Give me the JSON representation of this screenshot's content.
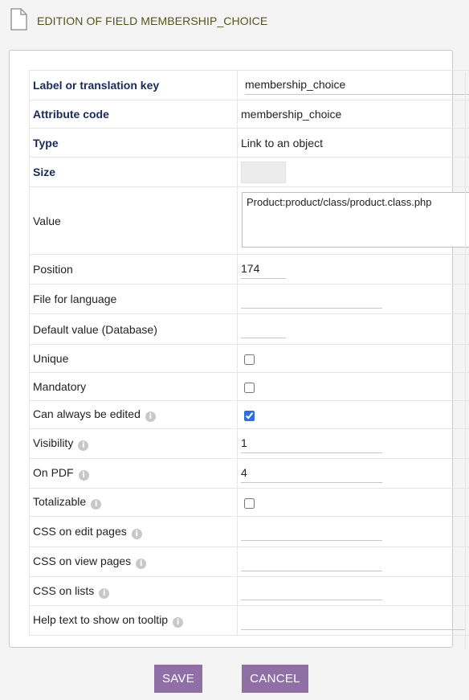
{
  "header": {
    "title": "EDITION OF FIELD MEMBERSHIP_CHOICE"
  },
  "form": {
    "label_key": {
      "label": "Label or translation key",
      "value": "membership_choice"
    },
    "attribute_code": {
      "label": "Attribute code",
      "value": "membership_choice"
    },
    "type": {
      "label": "Type",
      "value": "Link to an object"
    },
    "size": {
      "label": "Size",
      "value": ""
    },
    "value": {
      "label": "Value",
      "value": "Product:product/class/product.class.php"
    },
    "position": {
      "label": "Position",
      "value": "174"
    },
    "file_language": {
      "label": "File for language",
      "value": ""
    },
    "default_value": {
      "label": "Default value (Database)",
      "value": ""
    },
    "unique": {
      "label": "Unique",
      "checked": false
    },
    "mandatory": {
      "label": "Mandatory",
      "checked": false
    },
    "always_editable": {
      "label": "Can always be edited",
      "checked": true
    },
    "visibility": {
      "label": "Visibility",
      "value": "1"
    },
    "on_pdf": {
      "label": "On PDF",
      "value": "4"
    },
    "totalizable": {
      "label": "Totalizable",
      "checked": false
    },
    "css_edit": {
      "label": "CSS on edit pages",
      "value": ""
    },
    "css_view": {
      "label": "CSS on view pages",
      "value": ""
    },
    "css_list": {
      "label": "CSS on lists",
      "value": ""
    },
    "help_tooltip": {
      "label": "Help text to show on tooltip",
      "value": ""
    }
  },
  "buttons": {
    "save": "SAVE",
    "cancel": "CANCEL"
  },
  "icons": {
    "page": "document-icon",
    "info": "info-icon"
  },
  "colors": {
    "button_bg": "#8f6fa6",
    "title_text": "#55551a",
    "label_bold": "#1a2a57"
  }
}
